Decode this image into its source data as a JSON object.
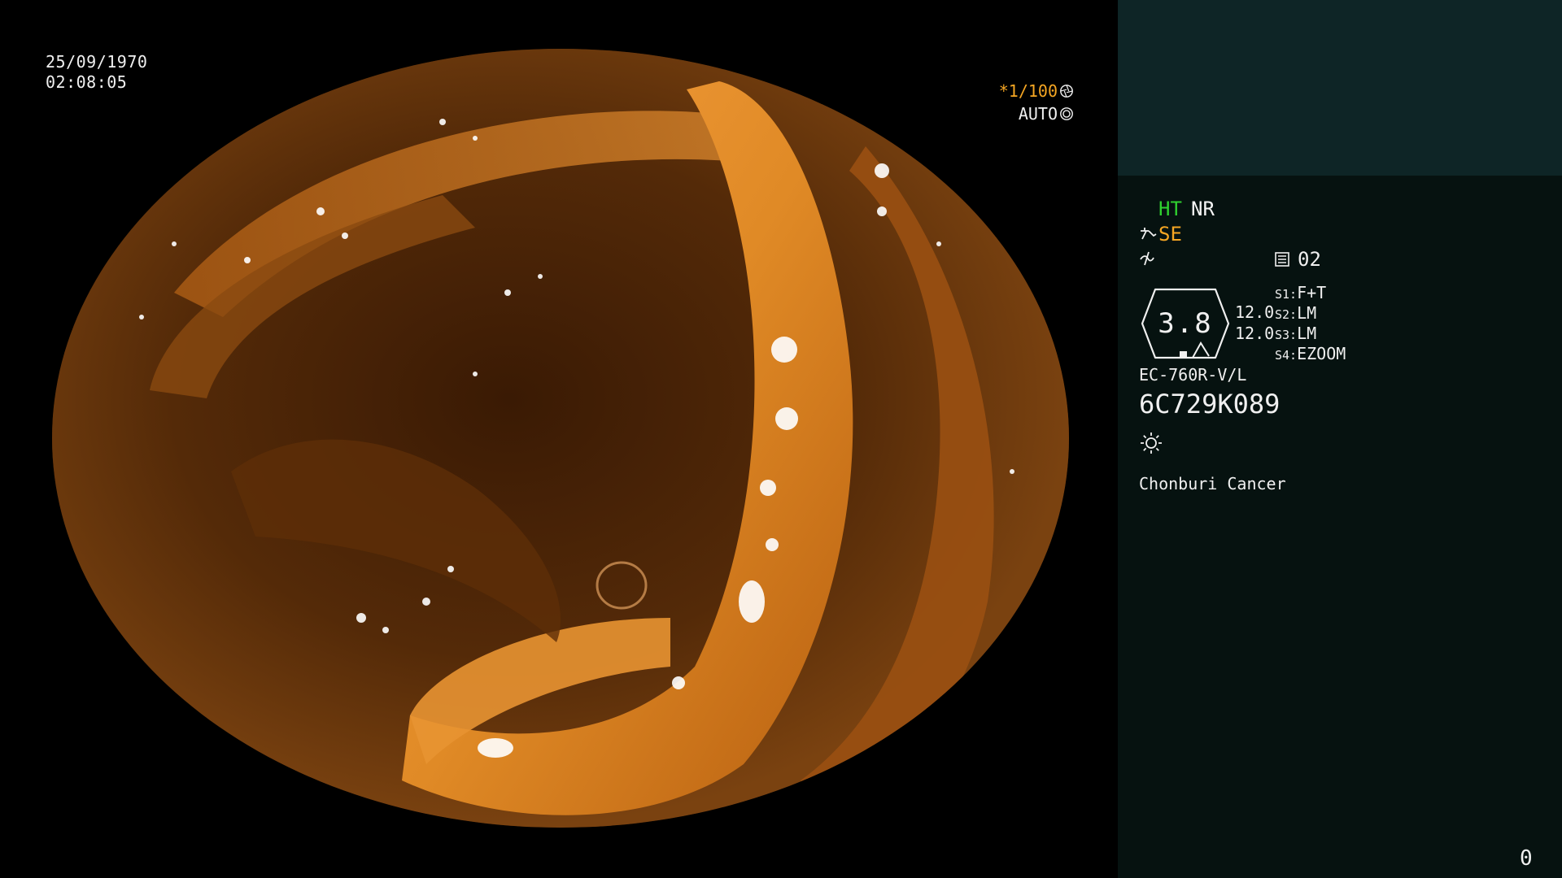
{
  "osd": {
    "date": "25/09/1970",
    "time": "02:08:05",
    "shutter": "*1/100",
    "shutter_icon": "aperture-icon",
    "exposure_mode": "AUTO",
    "exposure_icon": "iris-icon"
  },
  "panel": {
    "ht": "HT",
    "nr": "NR",
    "se": "SE",
    "memo_number": "02",
    "gauge_value": "3.8",
    "gauge_right_1": "12.0",
    "gauge_right_2": "12.0",
    "switches": [
      {
        "key": "S1:",
        "value": "F+T"
      },
      {
        "key": "S2:",
        "value": "LM"
      },
      {
        "key": "S3:",
        "value": "LM"
      },
      {
        "key": "S4:",
        "value": "EZOOM"
      }
    ],
    "scope_model": "EC-760R-V/L",
    "scope_serial": "6C729K089",
    "light_icon": "sun-icon",
    "hospital": "Chonburi Cancer",
    "counter": "0"
  },
  "colors": {
    "ht": "#2fd12f",
    "se": "#f5a623",
    "shutter": "#f5a623",
    "panel_bg": "#061210",
    "panel_top_bg": "#0e2526"
  }
}
